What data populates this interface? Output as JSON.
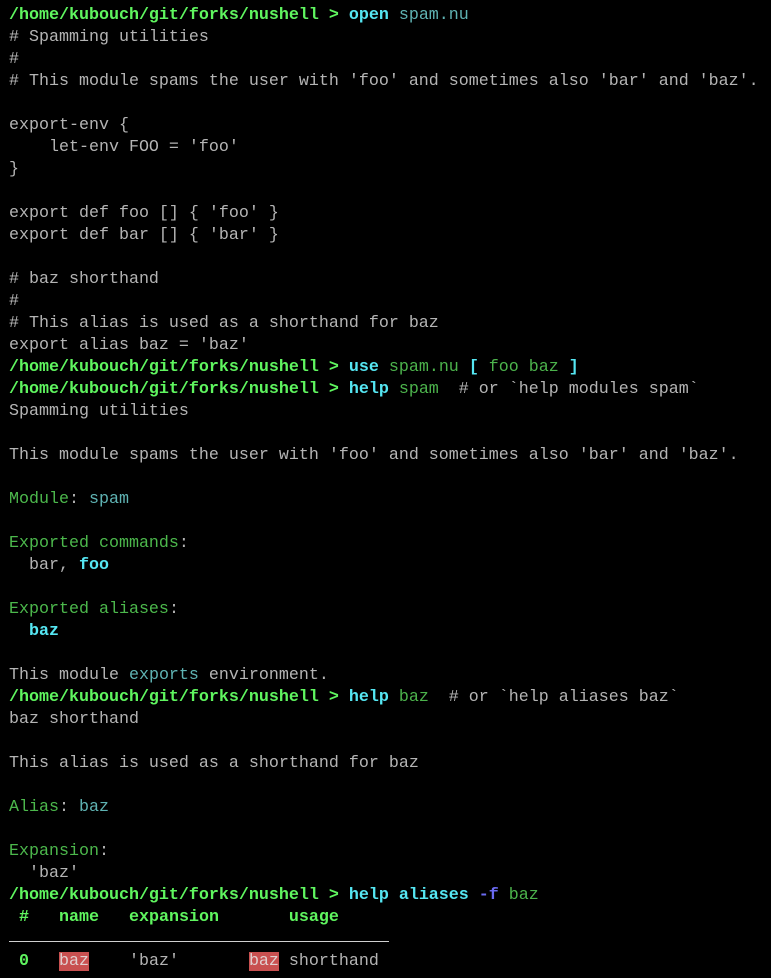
{
  "terminal": {
    "colors": {
      "prompt": "#5ff55f",
      "command": "#55e6f2",
      "argument": "#4cb34c",
      "text": "#b4b4b4",
      "flag": "#6a6af0",
      "highlight": "#c85050"
    },
    "lines": [
      [
        [
          "/home/kubouch/git/forks/nushell > ",
          "p"
        ],
        [
          "open",
          "c"
        ],
        [
          " spam.nu",
          "s"
        ]
      ],
      [
        [
          "# Spamming utilities",
          "t"
        ]
      ],
      [
        [
          "#",
          "t"
        ]
      ],
      [
        [
          "# This module spams the user with 'foo' and sometimes also 'bar' and 'baz'.",
          "t"
        ]
      ],
      [],
      [
        [
          "export-env {",
          "t"
        ]
      ],
      [
        [
          "    let-env FOO = 'foo'",
          "t"
        ]
      ],
      [
        [
          "}",
          "t"
        ]
      ],
      [],
      [
        [
          "export def foo [] { 'foo' }",
          "t"
        ]
      ],
      [
        [
          "export def bar [] { 'bar' }",
          "t"
        ]
      ],
      [],
      [
        [
          "# baz shorthand",
          "t"
        ]
      ],
      [
        [
          "#",
          "t"
        ]
      ],
      [
        [
          "# This alias is used as a shorthand for baz",
          "t"
        ]
      ],
      [
        [
          "export alias baz = 'baz'",
          "t"
        ]
      ],
      [
        [
          "/home/kubouch/git/forks/nushell > ",
          "p"
        ],
        [
          "use",
          "c"
        ],
        [
          " spam.nu ",
          "a"
        ],
        [
          "[",
          "b"
        ],
        [
          " foo baz ",
          "a"
        ],
        [
          "]",
          "b"
        ]
      ],
      [
        [
          "/home/kubouch/git/forks/nushell > ",
          "p"
        ],
        [
          "help",
          "c"
        ],
        [
          " spam",
          "a"
        ],
        [
          "  # or `help modules spam`",
          "t"
        ]
      ],
      [
        [
          "Spamming utilities",
          "t"
        ]
      ],
      [],
      [
        [
          "This module spams the user with 'foo' and sometimes also 'bar' and 'baz'.",
          "t"
        ]
      ],
      [],
      [
        [
          "Module",
          "h"
        ],
        [
          ": ",
          "t"
        ],
        [
          "spam",
          "s"
        ]
      ],
      [],
      [
        [
          "Exported commands",
          "h"
        ],
        [
          ":",
          "t"
        ]
      ],
      [
        [
          "  bar, ",
          "t"
        ],
        [
          "foo",
          "b"
        ]
      ],
      [],
      [
        [
          "Exported aliases",
          "h"
        ],
        [
          ":",
          "t"
        ]
      ],
      [
        [
          "  ",
          "t"
        ],
        [
          "baz",
          "b"
        ]
      ],
      [],
      [
        [
          "This module ",
          "t"
        ],
        [
          "exports",
          "s"
        ],
        [
          " environment.",
          "t"
        ]
      ],
      [
        [
          "/home/kubouch/git/forks/nushell > ",
          "p"
        ],
        [
          "help",
          "c"
        ],
        [
          " baz",
          "a"
        ],
        [
          "  # or `help aliases baz`",
          "t"
        ]
      ],
      [
        [
          "baz shorthand",
          "t"
        ]
      ],
      [],
      [
        [
          "This alias is used as a shorthand for baz",
          "t"
        ]
      ],
      [],
      [
        [
          "Alias",
          "h"
        ],
        [
          ": ",
          "t"
        ],
        [
          "baz",
          "s"
        ]
      ],
      [],
      [
        [
          "Expansion",
          "h"
        ],
        [
          ":",
          "t"
        ]
      ],
      [
        [
          "  'baz'",
          "t"
        ]
      ],
      [
        [
          "/home/kubouch/git/forks/nushell > ",
          "p"
        ],
        [
          "help",
          "c"
        ],
        [
          " aliases",
          "c"
        ],
        [
          " -f",
          "f"
        ],
        [
          " baz",
          "a"
        ]
      ],
      [
        [
          " #",
          "g"
        ],
        [
          "   ",
          "t"
        ],
        [
          "name",
          "g"
        ],
        [
          "   ",
          "t"
        ],
        [
          "expansion",
          "g"
        ],
        [
          "       ",
          "t"
        ],
        [
          "usage",
          "g"
        ]
      ],
      "separator",
      [
        [
          " 0",
          "g"
        ],
        [
          "   ",
          "t"
        ],
        [
          "baz",
          "hl"
        ],
        [
          "    'baz'       ",
          "t"
        ],
        [
          "baz",
          "hl"
        ],
        [
          " shorthand",
          "t"
        ]
      ]
    ]
  }
}
